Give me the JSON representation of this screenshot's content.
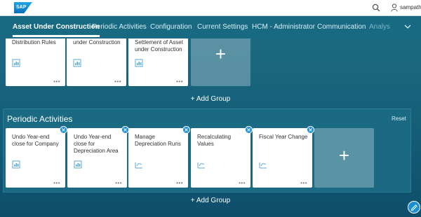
{
  "shell": {
    "logo_text": "SAP",
    "user_name": "sampath"
  },
  "tabs": [
    {
      "label": "Asset Under Construction",
      "active": true
    },
    {
      "label": "Periodic Activities"
    },
    {
      "label": "Configuration"
    },
    {
      "label": "Current Settings"
    },
    {
      "label": "HCM - Administrator"
    },
    {
      "label": "Communication"
    },
    {
      "label": "Analys"
    }
  ],
  "top_group": {
    "tiles": [
      {
        "title": "Settlement Distribution Rules"
      },
      {
        "title": "Settlement Asset under Construction"
      },
      {
        "title": "Individual Settlement of Asset under Construction"
      }
    ],
    "add_tile_symbol": "+",
    "add_group_label": "+ Add Group"
  },
  "periodic_group": {
    "title": "Periodic Activities",
    "reset_label": "Reset",
    "tiles": [
      {
        "title": "Undo Year-end close for Company"
      },
      {
        "title": "Undo Year-end close for Depreciation Area"
      },
      {
        "title": "Manage Depreciation Runs"
      },
      {
        "title": "Recalculating Values"
      },
      {
        "title": "Fiscal Year Change"
      }
    ],
    "add_tile_symbol": "+",
    "add_group_label": "+ Add Group"
  },
  "tile_more_symbol": "•••",
  "colors": {
    "accent": "#1a8fd4",
    "background": "#176a82",
    "tile": "#ffffff"
  }
}
